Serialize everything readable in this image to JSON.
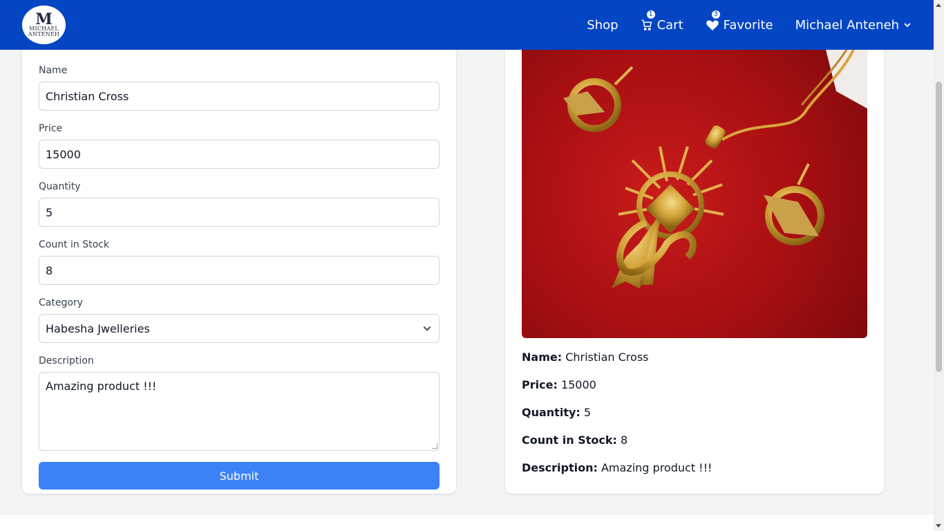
{
  "brand": {
    "logo_mark": "M",
    "logo_line1": "MICHAEL",
    "logo_line2": "ANTENEH"
  },
  "nav": {
    "shop": "Shop",
    "cart": "Cart",
    "cart_count": "1",
    "favorite": "Favorite",
    "favorite_count": "3",
    "user": "Michael Anteneh"
  },
  "form": {
    "name_label": "Name",
    "name_value": "Christian Cross",
    "price_label": "Price",
    "price_value": "15000",
    "quantity_label": "Quantity",
    "quantity_value": "5",
    "stock_label": "Count in Stock",
    "stock_value": "8",
    "category_label": "Category",
    "category_value": "Habesha Jwelleries",
    "description_label": "Description",
    "description_value": "Amazing product !!!",
    "submit_label": "Submit"
  },
  "preview": {
    "name_label": "Name:",
    "name_value": "Christian Cross",
    "price_label": "Price:",
    "price_value": "15000",
    "quantity_label": "Quantity:",
    "quantity_value": "5",
    "stock_label": "Count in Stock:",
    "stock_value": "8",
    "description_label": "Description:",
    "description_value": "Amazing product !!!"
  },
  "colors": {
    "navbar": "#0445c4",
    "submit": "#3b82f6",
    "background": "#f3f4f6"
  }
}
